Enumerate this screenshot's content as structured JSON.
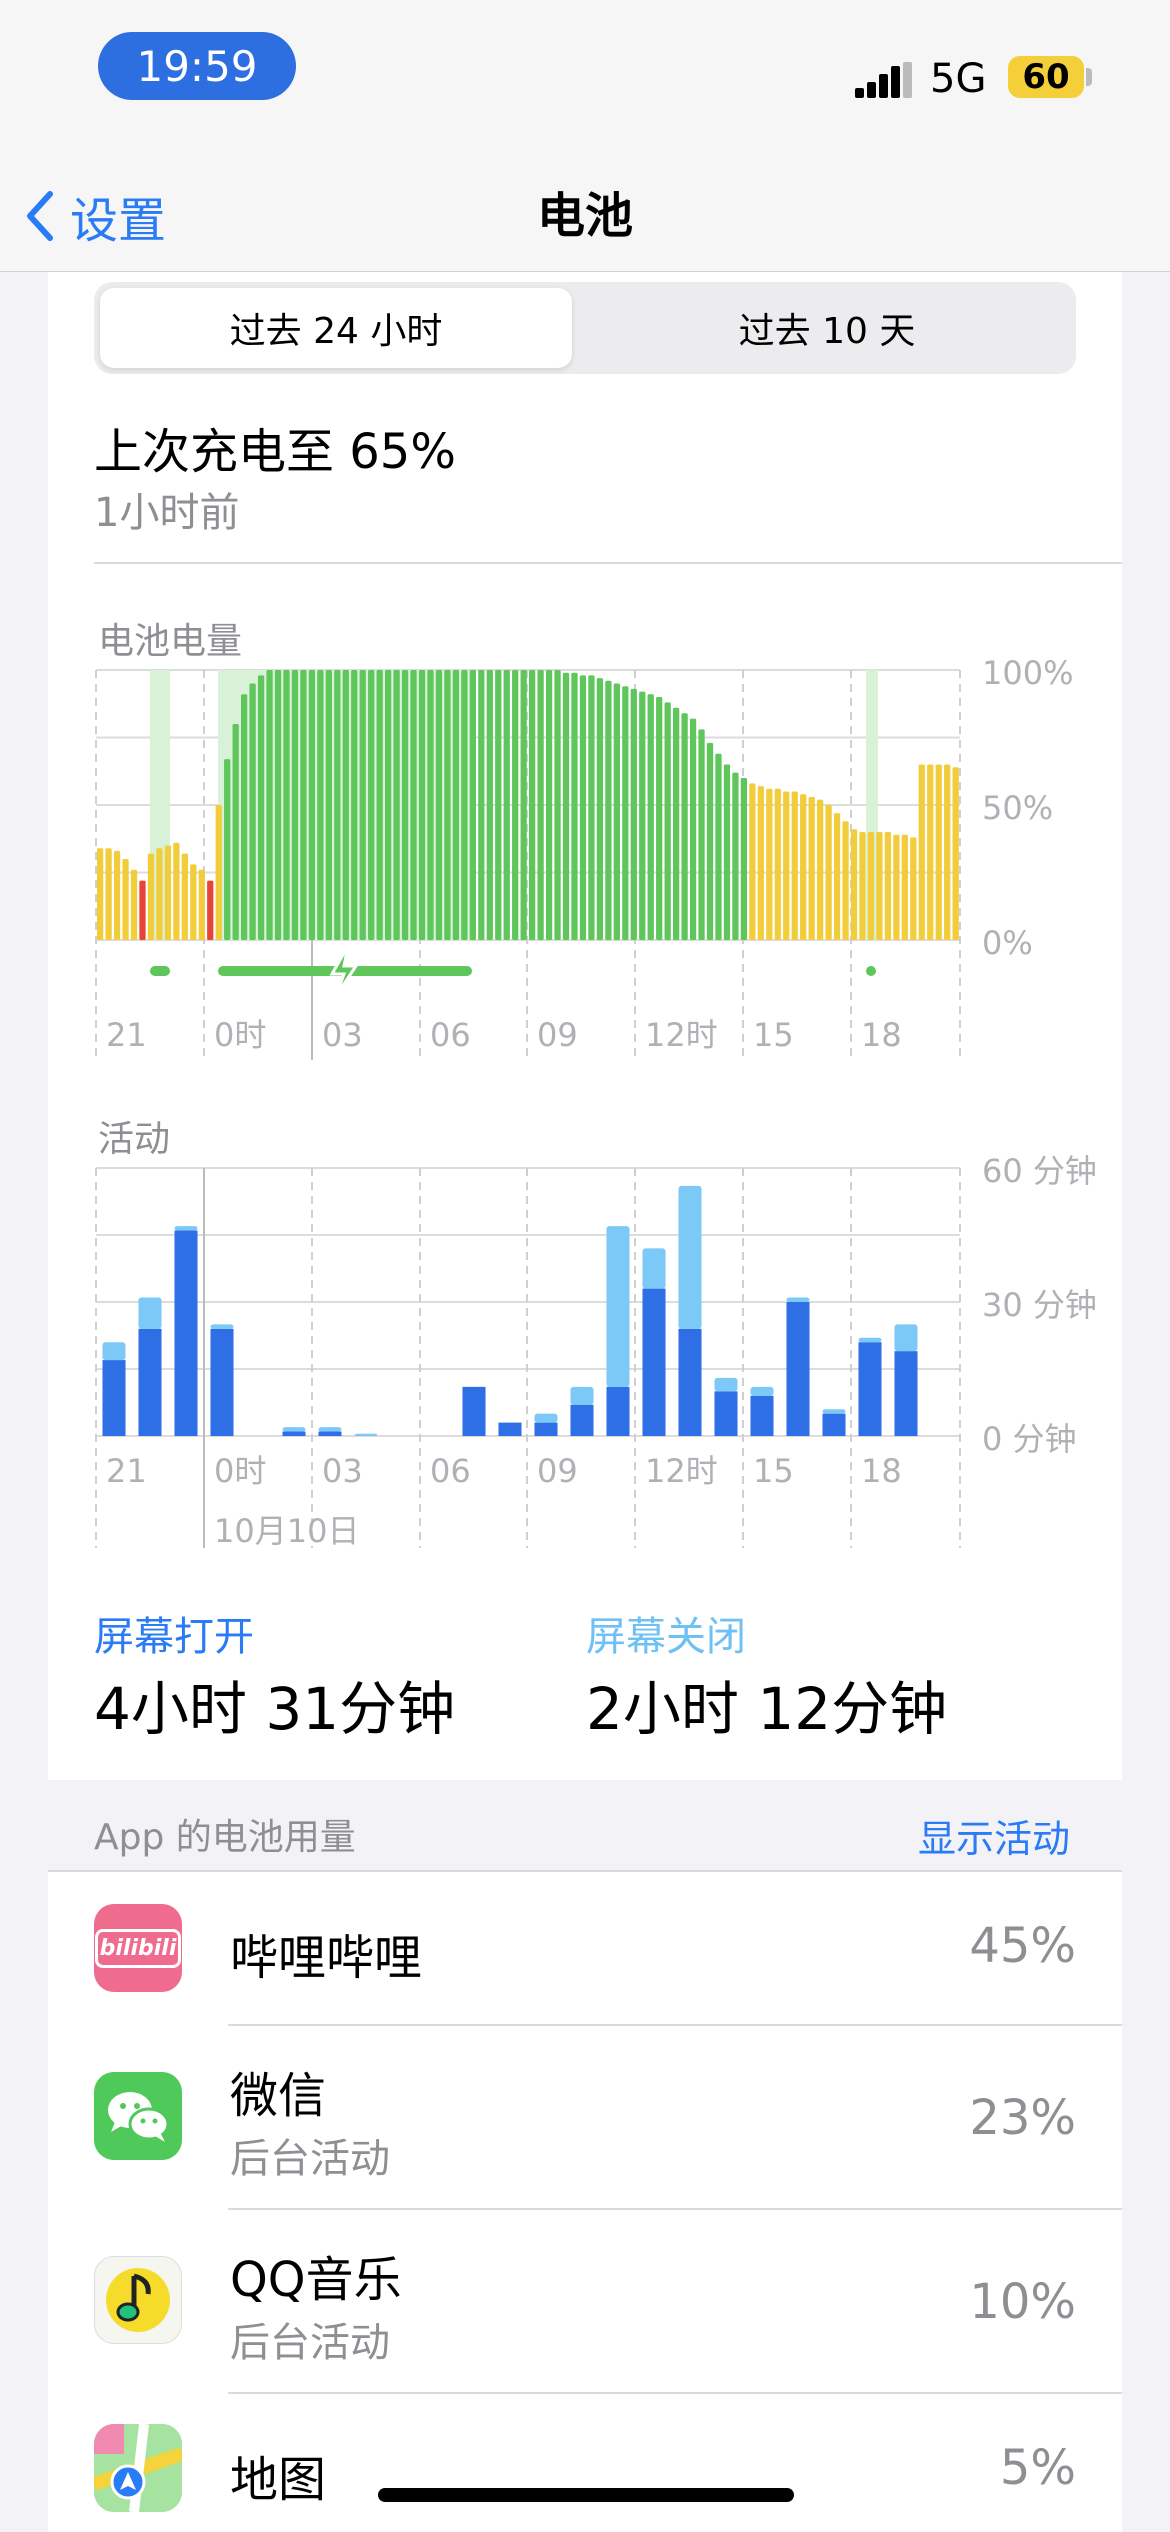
{
  "status_bar": {
    "time": "19:59",
    "network": "5G",
    "battery": "60"
  },
  "nav": {
    "back_label": "设置",
    "title": "电池"
  },
  "segments": {
    "active": "过去 24 小时",
    "other": "过去 10 天"
  },
  "last_charge": {
    "title": "上次充电至 65%",
    "subtitle": "1小时前"
  },
  "battery_chart": {
    "label": "电池电量",
    "y_ticks": [
      "100%",
      "50%",
      "0%"
    ],
    "x_ticks": [
      "21",
      "0时",
      "03",
      "06",
      "09",
      "12时",
      "15",
      "18"
    ]
  },
  "activity_chart": {
    "label": "活动",
    "y_ticks": [
      "60 分钟",
      "30 分钟",
      "0 分钟"
    ],
    "x_ticks": [
      "21",
      "0时",
      "03",
      "06",
      "09",
      "12时",
      "15",
      "18"
    ],
    "date_label": "10月10日"
  },
  "chart_data": [
    {
      "type": "bar",
      "title": "电池电量",
      "ylim": [
        0,
        100
      ],
      "x_ticks": [
        "21",
        "0时",
        "03",
        "06",
        "09",
        "12时",
        "15",
        "18"
      ],
      "values": [
        34,
        34,
        33,
        30,
        26,
        22,
        32,
        34,
        35,
        36,
        32,
        28,
        26,
        22,
        50,
        67,
        80,
        91,
        95,
        98,
        100,
        100,
        100,
        100,
        100,
        100,
        100,
        100,
        100,
        100,
        100,
        100,
        100,
        100,
        100,
        100,
        100,
        100,
        100,
        100,
        100,
        100,
        100,
        100,
        100,
        100,
        100,
        100,
        100,
        100,
        100,
        100,
        100,
        100,
        100,
        99,
        99,
        98,
        98,
        97,
        96,
        95,
        94,
        93,
        92,
        91,
        90,
        88,
        86,
        84,
        82,
        78,
        73,
        69,
        65,
        62,
        60,
        58,
        57,
        56,
        56,
        55,
        55,
        54,
        53,
        52,
        50,
        47,
        44,
        41,
        40,
        40,
        40,
        40,
        39,
        39,
        38,
        65,
        65,
        65,
        65,
        64
      ],
      "colors_hint": "yellow ≤ normal, red = low, green = charging/high",
      "charging_periods": [
        "~22时",
        "0时–~06时",
        "~18时"
      ]
    },
    {
      "type": "bar",
      "title": "活动",
      "ylabel": "分钟",
      "ylim": [
        0,
        60
      ],
      "categories": [
        "20",
        "21",
        "22",
        "23",
        "0",
        "1",
        "2",
        "3",
        "4",
        "5",
        "6",
        "7",
        "8",
        "9",
        "10",
        "11",
        "12",
        "13",
        "14",
        "15",
        "16",
        "17",
        "18",
        "19"
      ],
      "series": [
        {
          "name": "屏幕打开",
          "values": [
            17,
            24,
            46,
            24,
            0,
            1,
            1,
            0,
            0,
            0,
            11,
            3,
            3,
            7,
            11,
            33,
            24,
            10,
            9,
            30,
            5,
            21,
            19,
            0
          ]
        },
        {
          "name": "屏幕关闭",
          "values": [
            4,
            7,
            1,
            1,
            0,
            1,
            1,
            0.5,
            0,
            0,
            0,
            0,
            2,
            4,
            36,
            9,
            32,
            3,
            2,
            1,
            1,
            1,
            6,
            0
          ]
        }
      ]
    }
  ],
  "screen_stats": {
    "on_label": "屏幕打开",
    "on_value": "4小时 31分钟",
    "off_label": "屏幕关闭",
    "off_value": "2小时 12分钟"
  },
  "app_usage": {
    "header": "App 的电池用量",
    "show_activity": "显示活动",
    "apps": [
      {
        "name": "哔哩哔哩",
        "sub": "",
        "percent": "45%",
        "icon": "bilibili-icon",
        "icon_text": "bilibili"
      },
      {
        "name": "微信",
        "sub": "后台活动",
        "percent": "23%",
        "icon": "wechat-icon"
      },
      {
        "name": "QQ音乐",
        "sub": "后台活动",
        "percent": "10%",
        "icon": "qq-music-icon"
      },
      {
        "name": "地图",
        "sub": "",
        "percent": "5%",
        "icon": "maps-icon"
      }
    ]
  },
  "colors": {
    "accent": "#2a7bf6",
    "screen_on": "#2f6fe6",
    "screen_off": "#7cc8f7",
    "green": "#5ec65a",
    "yellow": "#f2cd3b",
    "red": "#e8453a"
  }
}
